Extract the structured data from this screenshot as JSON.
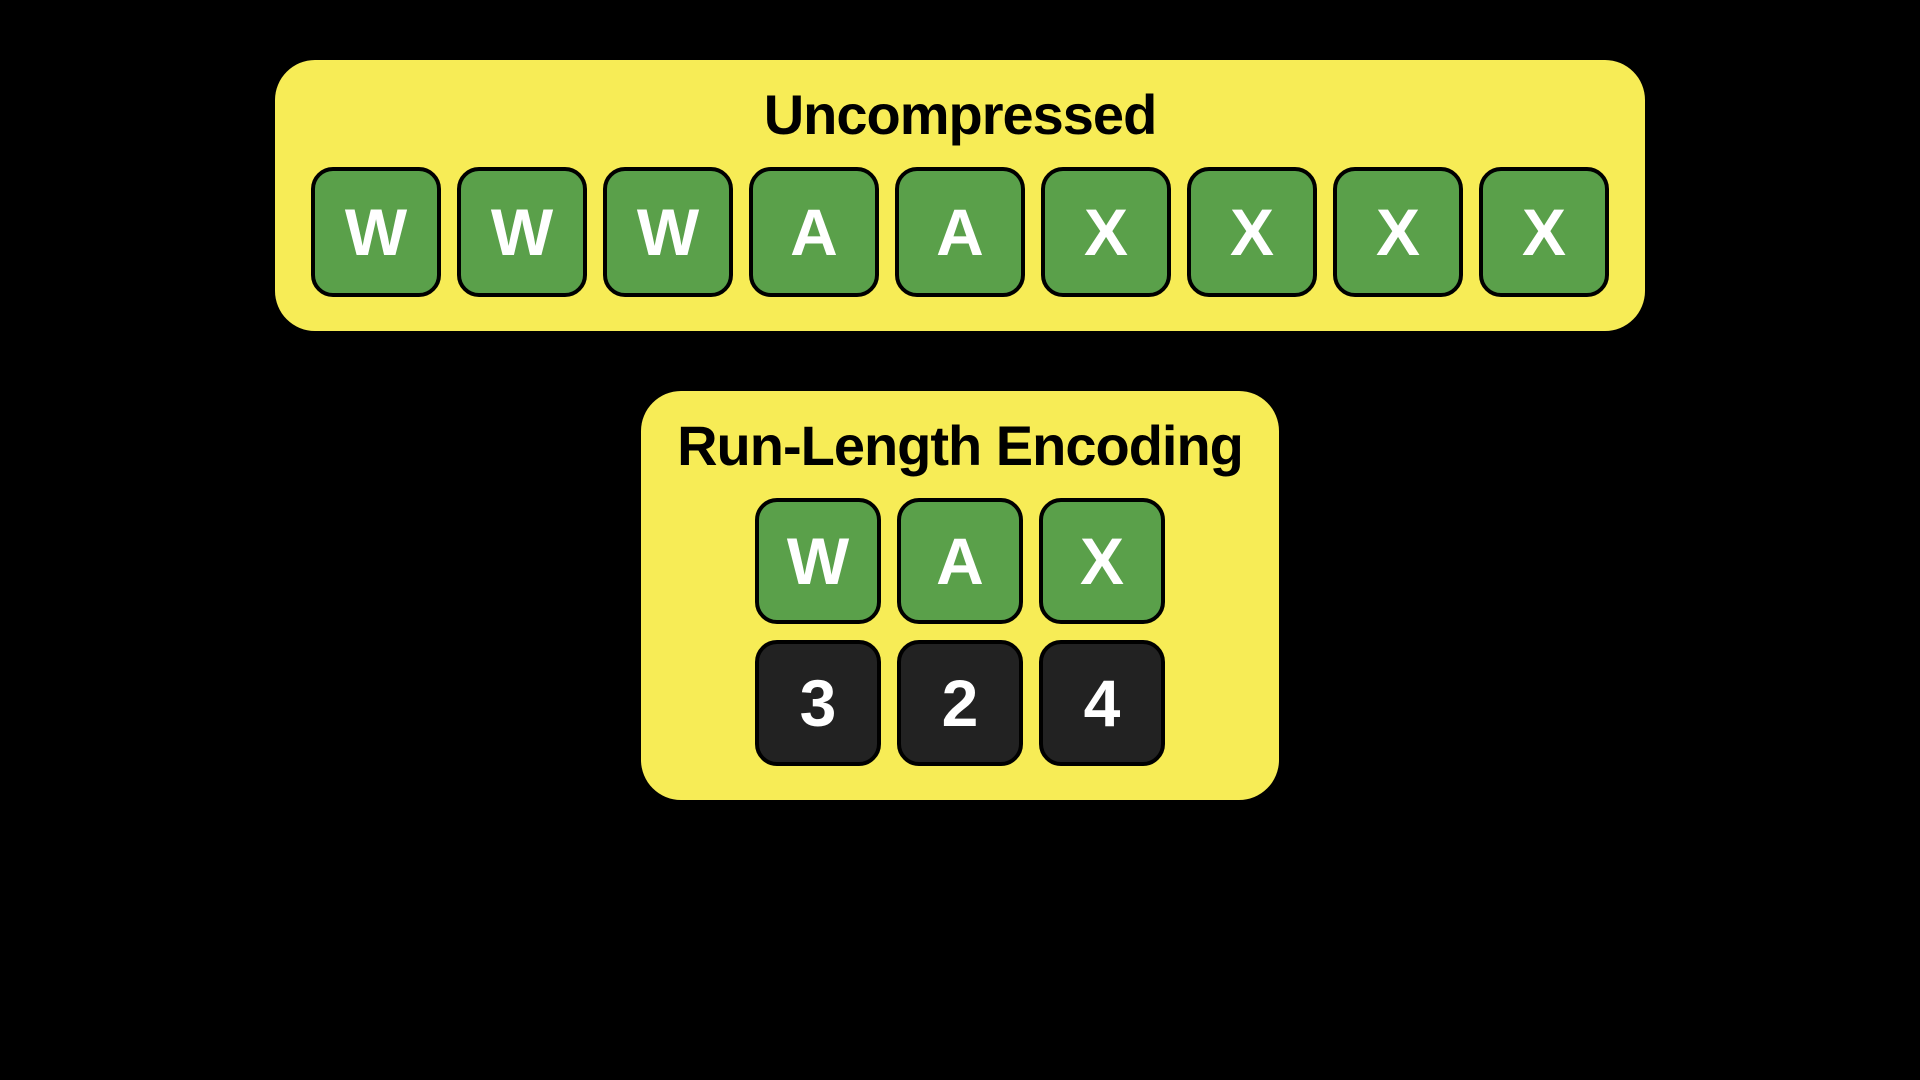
{
  "uncompressed": {
    "title": "Uncompressed",
    "chars": [
      "W",
      "W",
      "W",
      "A",
      "A",
      "X",
      "X",
      "X",
      "X"
    ]
  },
  "rle": {
    "title": "Run-Length Encoding",
    "chars": [
      "W",
      "A",
      "X"
    ],
    "counts": [
      "3",
      "2",
      "4"
    ]
  },
  "colors": {
    "panel_bg": "#f7ec56",
    "char_tile_bg": "#5aa04a",
    "count_tile_bg": "#222222",
    "page_bg": "#000000"
  }
}
